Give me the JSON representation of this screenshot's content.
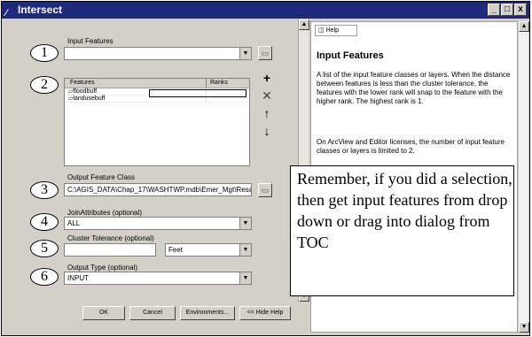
{
  "window": {
    "title": "Intersect",
    "title_icon": "hammer-icon",
    "min_glyph": "_",
    "max_glyph": "□",
    "close_glyph": "x"
  },
  "form": {
    "input_features_label": "Input Features",
    "input_features_value": "",
    "table": {
      "col_features": "Features",
      "col_ranks": "Ranks",
      "rows": [
        {
          "name": "floodbuff",
          "rank": ""
        },
        {
          "name": "landusebuff",
          "rank": ""
        }
      ]
    },
    "output_label": "Output Feature Class",
    "output_value": "C:\\AGIS_DATA\\Chap_17\\WASHTWP.mdb\\Emer_Mgt\\Resa",
    "join_label": "JoinAttributes (optional)",
    "join_value": "ALL",
    "cluster_label": "Cluster Tolerance (optional)",
    "cluster_value": "",
    "cluster_units": "Feet",
    "output_type_label": "Output Type (optional)",
    "output_type_value": "INPUT"
  },
  "buttons": {
    "ok": "OK",
    "cancel": "Cancel",
    "environments": "Environments...",
    "hide_help": "<< Hide Help"
  },
  "callout_numbers": [
    "1",
    "2",
    "3",
    "4",
    "5",
    "6"
  ],
  "help": {
    "tab_label": "Help",
    "title": "Input Features",
    "para1": "A list of the input feature classes or layers. When the distance between features is less than the cluster tolerance, the features with the lower rank will snap to the feature with the higher rank. The highest rank is 1.",
    "para2": "On ArcView and Editor licenses, the number of input feature classes or layers is limited to 2."
  },
  "callout_note": "Remember, if you did a selection, then get input features from drop down or drag into dialog from TOC"
}
